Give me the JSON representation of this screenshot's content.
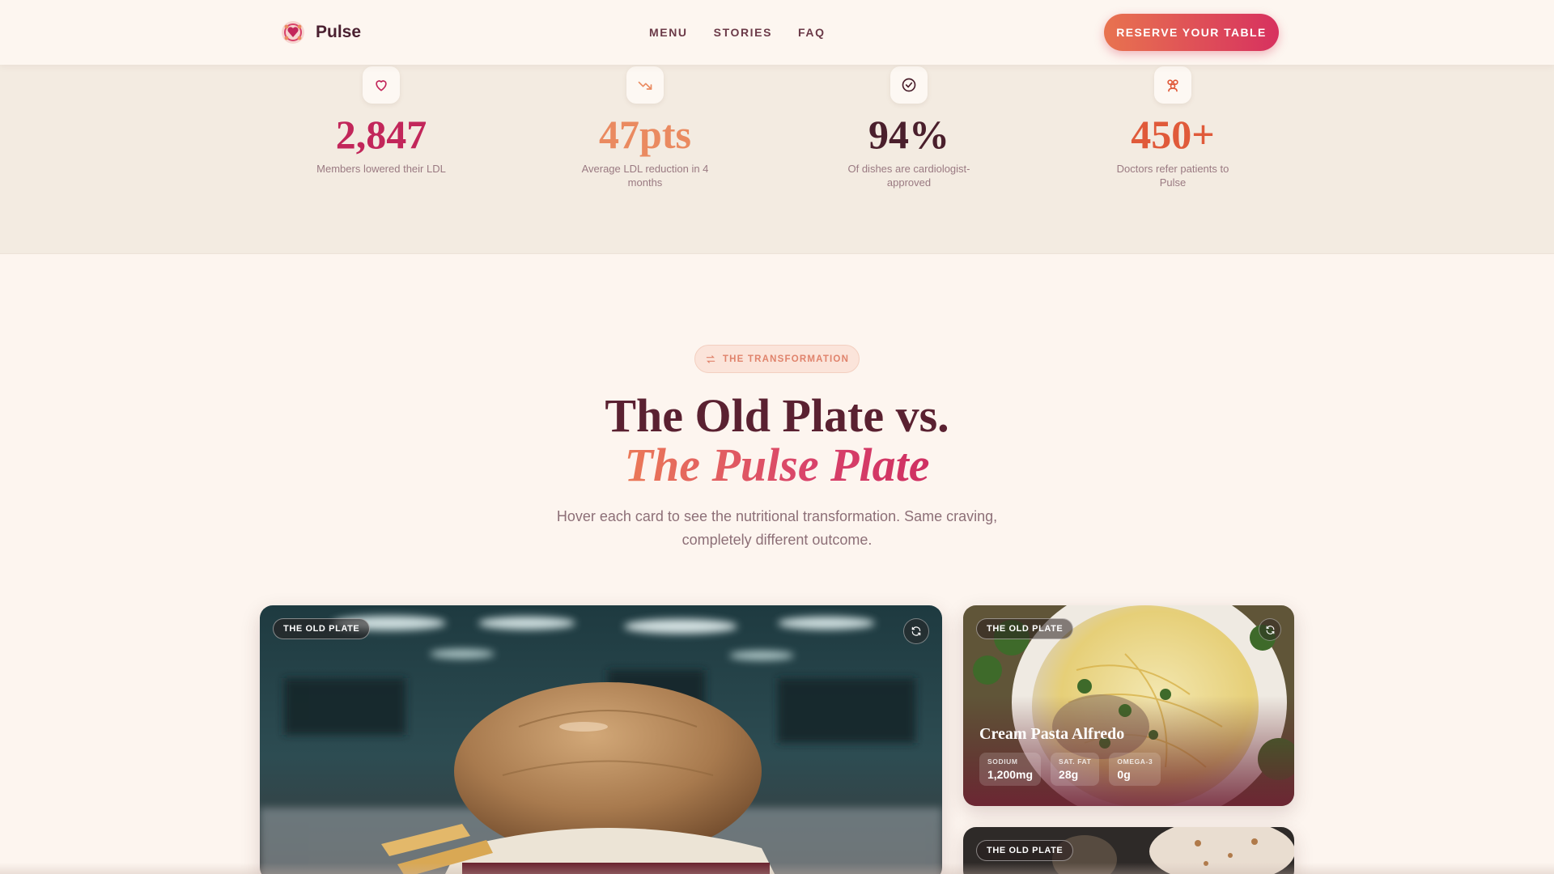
{
  "header": {
    "brand": "Pulse",
    "nav": [
      "MENU",
      "STORIES",
      "FAQ"
    ],
    "cta": "RESERVE YOUR TABLE"
  },
  "stats": [
    {
      "icon": "heart-icon",
      "value": "2,847",
      "label": "Members lowered their LDL",
      "color": "#c2265a"
    },
    {
      "icon": "trend-down-icon",
      "value": "47pts",
      "label": "Average LDL reduction in 4 months",
      "color": "#ea8a60"
    },
    {
      "icon": "check-circle-icon",
      "value": "94%",
      "label": "Of dishes are cardiologist-approved",
      "color": "#4a1f2c"
    },
    {
      "icon": "doctors-icon",
      "value": "450+",
      "label": "Doctors refer patients to Pulse",
      "color": "#e05a3a"
    }
  ],
  "transformation": {
    "pill": "THE TRANSFORMATION",
    "title_line1": "The Old Plate vs.",
    "title_line2": "The Pulse Plate",
    "subtitle": "Hover each card to see the nutritional transformation. Same craving, completely different outcome."
  },
  "cards": [
    {
      "tag": "THE OLD PLATE"
    },
    {
      "tag": "THE OLD PLATE",
      "name": "Cream Pasta Alfredo",
      "metrics": [
        {
          "label": "SODIUM",
          "value": "1,200mg"
        },
        {
          "label": "SAT. FAT",
          "value": "28g"
        },
        {
          "label": "OMEGA-3",
          "value": "0g"
        }
      ]
    },
    {
      "tag": "THE OLD PLATE"
    }
  ]
}
